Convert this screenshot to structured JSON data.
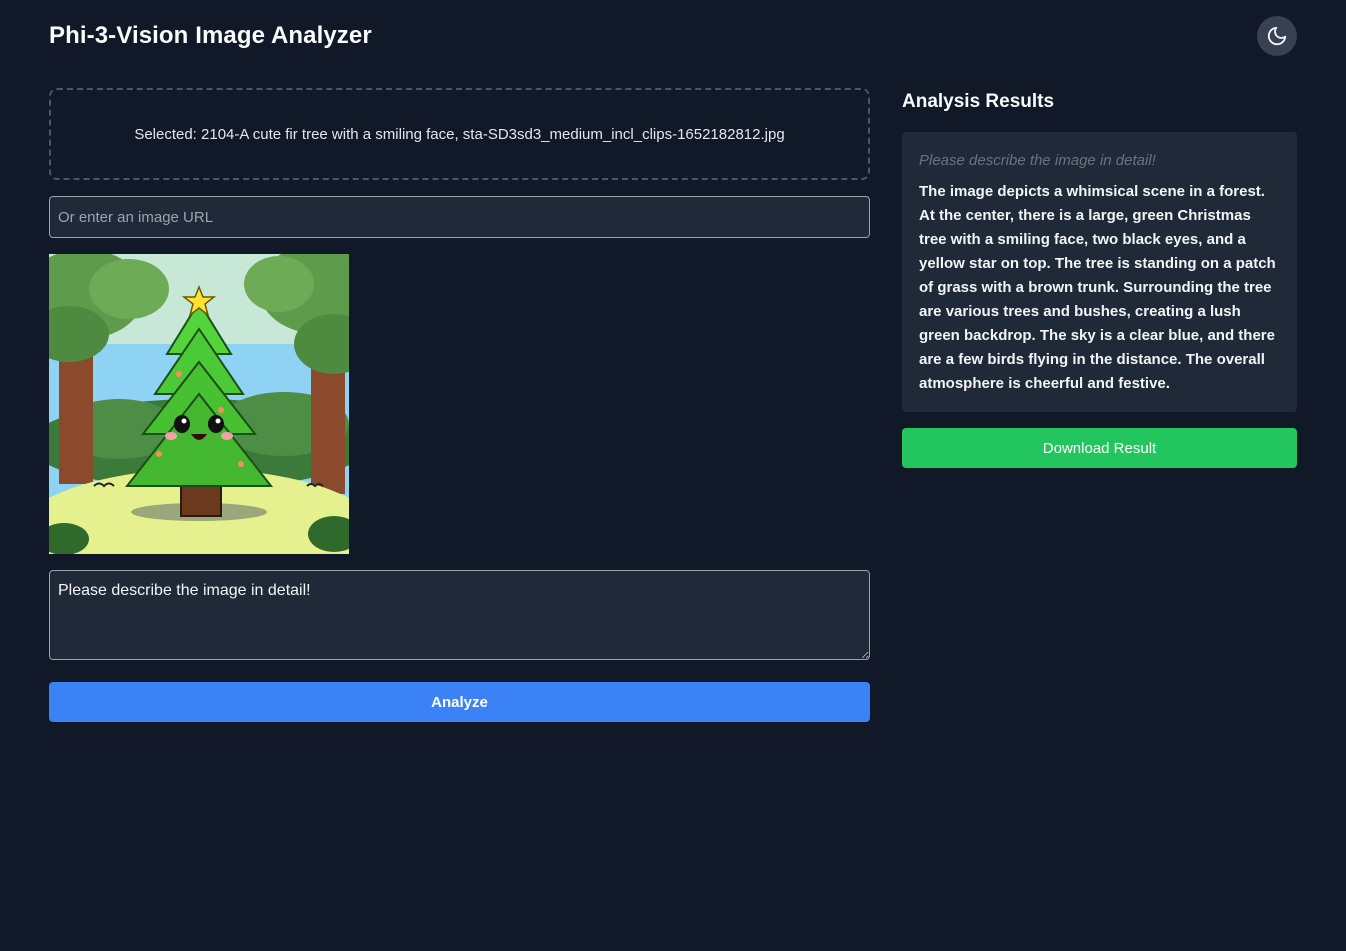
{
  "header": {
    "title": "Phi-3-Vision Image Analyzer",
    "theme_icon": "moon-icon"
  },
  "upload": {
    "selected_text": "Selected: 2104-A cute fir tree with a smiling face, sta-SD3sd3_medium_incl_clips-1652182812.jpg",
    "url_placeholder": "Or enter an image URL",
    "url_value": ""
  },
  "preview": {
    "alt": "cute fir tree with a smiling face"
  },
  "prompt": {
    "value": "Please describe the image in detail!"
  },
  "actions": {
    "analyze_label": "Analyze",
    "download_label": "Download Result"
  },
  "results": {
    "heading": "Analysis Results",
    "prompt_echo": "Please describe the image in detail!",
    "text": "The image depicts a whimsical scene in a forest. At the center, there is a large, green Christmas tree with a smiling face, two black eyes, and a yellow star on top. The tree is standing on a patch of grass with a brown trunk. Surrounding the tree are various trees and bushes, creating a lush green backdrop. The sky is a clear blue, and there are a few birds flying in the distance. The overall atmosphere is cheerful and festive."
  },
  "colors": {
    "background": "#111827",
    "panel": "#1f2937",
    "primary": "#3b82f6",
    "success": "#22c55e"
  }
}
